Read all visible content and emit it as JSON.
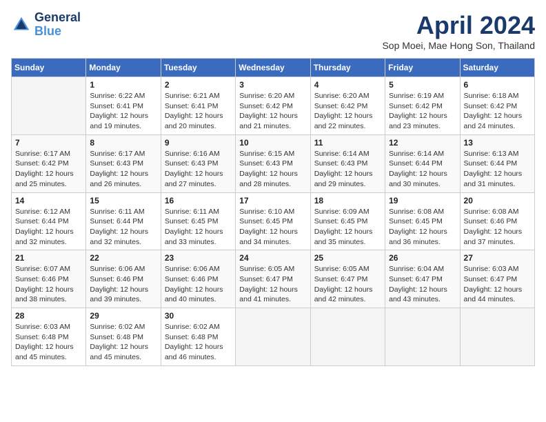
{
  "header": {
    "logo": {
      "line1": "General",
      "line2": "Blue"
    },
    "title": "April 2024",
    "subtitle": "Sop Moei, Mae Hong Son, Thailand"
  },
  "weekdays": [
    "Sunday",
    "Monday",
    "Tuesday",
    "Wednesday",
    "Thursday",
    "Friday",
    "Saturday"
  ],
  "weeks": [
    [
      {
        "day": "",
        "info": ""
      },
      {
        "day": "1",
        "info": "Sunrise: 6:22 AM\nSunset: 6:41 PM\nDaylight: 12 hours\nand 19 minutes."
      },
      {
        "day": "2",
        "info": "Sunrise: 6:21 AM\nSunset: 6:41 PM\nDaylight: 12 hours\nand 20 minutes."
      },
      {
        "day": "3",
        "info": "Sunrise: 6:20 AM\nSunset: 6:42 PM\nDaylight: 12 hours\nand 21 minutes."
      },
      {
        "day": "4",
        "info": "Sunrise: 6:20 AM\nSunset: 6:42 PM\nDaylight: 12 hours\nand 22 minutes."
      },
      {
        "day": "5",
        "info": "Sunrise: 6:19 AM\nSunset: 6:42 PM\nDaylight: 12 hours\nand 23 minutes."
      },
      {
        "day": "6",
        "info": "Sunrise: 6:18 AM\nSunset: 6:42 PM\nDaylight: 12 hours\nand 24 minutes."
      }
    ],
    [
      {
        "day": "7",
        "info": "Sunrise: 6:17 AM\nSunset: 6:42 PM\nDaylight: 12 hours\nand 25 minutes."
      },
      {
        "day": "8",
        "info": "Sunrise: 6:17 AM\nSunset: 6:43 PM\nDaylight: 12 hours\nand 26 minutes."
      },
      {
        "day": "9",
        "info": "Sunrise: 6:16 AM\nSunset: 6:43 PM\nDaylight: 12 hours\nand 27 minutes."
      },
      {
        "day": "10",
        "info": "Sunrise: 6:15 AM\nSunset: 6:43 PM\nDaylight: 12 hours\nand 28 minutes."
      },
      {
        "day": "11",
        "info": "Sunrise: 6:14 AM\nSunset: 6:43 PM\nDaylight: 12 hours\nand 29 minutes."
      },
      {
        "day": "12",
        "info": "Sunrise: 6:14 AM\nSunset: 6:44 PM\nDaylight: 12 hours\nand 30 minutes."
      },
      {
        "day": "13",
        "info": "Sunrise: 6:13 AM\nSunset: 6:44 PM\nDaylight: 12 hours\nand 31 minutes."
      }
    ],
    [
      {
        "day": "14",
        "info": "Sunrise: 6:12 AM\nSunset: 6:44 PM\nDaylight: 12 hours\nand 32 minutes."
      },
      {
        "day": "15",
        "info": "Sunrise: 6:11 AM\nSunset: 6:44 PM\nDaylight: 12 hours\nand 32 minutes."
      },
      {
        "day": "16",
        "info": "Sunrise: 6:11 AM\nSunset: 6:45 PM\nDaylight: 12 hours\nand 33 minutes."
      },
      {
        "day": "17",
        "info": "Sunrise: 6:10 AM\nSunset: 6:45 PM\nDaylight: 12 hours\nand 34 minutes."
      },
      {
        "day": "18",
        "info": "Sunrise: 6:09 AM\nSunset: 6:45 PM\nDaylight: 12 hours\nand 35 minutes."
      },
      {
        "day": "19",
        "info": "Sunrise: 6:08 AM\nSunset: 6:45 PM\nDaylight: 12 hours\nand 36 minutes."
      },
      {
        "day": "20",
        "info": "Sunrise: 6:08 AM\nSunset: 6:46 PM\nDaylight: 12 hours\nand 37 minutes."
      }
    ],
    [
      {
        "day": "21",
        "info": "Sunrise: 6:07 AM\nSunset: 6:46 PM\nDaylight: 12 hours\nand 38 minutes."
      },
      {
        "day": "22",
        "info": "Sunrise: 6:06 AM\nSunset: 6:46 PM\nDaylight: 12 hours\nand 39 minutes."
      },
      {
        "day": "23",
        "info": "Sunrise: 6:06 AM\nSunset: 6:46 PM\nDaylight: 12 hours\nand 40 minutes."
      },
      {
        "day": "24",
        "info": "Sunrise: 6:05 AM\nSunset: 6:47 PM\nDaylight: 12 hours\nand 41 minutes."
      },
      {
        "day": "25",
        "info": "Sunrise: 6:05 AM\nSunset: 6:47 PM\nDaylight: 12 hours\nand 42 minutes."
      },
      {
        "day": "26",
        "info": "Sunrise: 6:04 AM\nSunset: 6:47 PM\nDaylight: 12 hours\nand 43 minutes."
      },
      {
        "day": "27",
        "info": "Sunrise: 6:03 AM\nSunset: 6:47 PM\nDaylight: 12 hours\nand 44 minutes."
      }
    ],
    [
      {
        "day": "28",
        "info": "Sunrise: 6:03 AM\nSunset: 6:48 PM\nDaylight: 12 hours\nand 45 minutes."
      },
      {
        "day": "29",
        "info": "Sunrise: 6:02 AM\nSunset: 6:48 PM\nDaylight: 12 hours\nand 45 minutes."
      },
      {
        "day": "30",
        "info": "Sunrise: 6:02 AM\nSunset: 6:48 PM\nDaylight: 12 hours\nand 46 minutes."
      },
      {
        "day": "",
        "info": ""
      },
      {
        "day": "",
        "info": ""
      },
      {
        "day": "",
        "info": ""
      },
      {
        "day": "",
        "info": ""
      }
    ]
  ]
}
